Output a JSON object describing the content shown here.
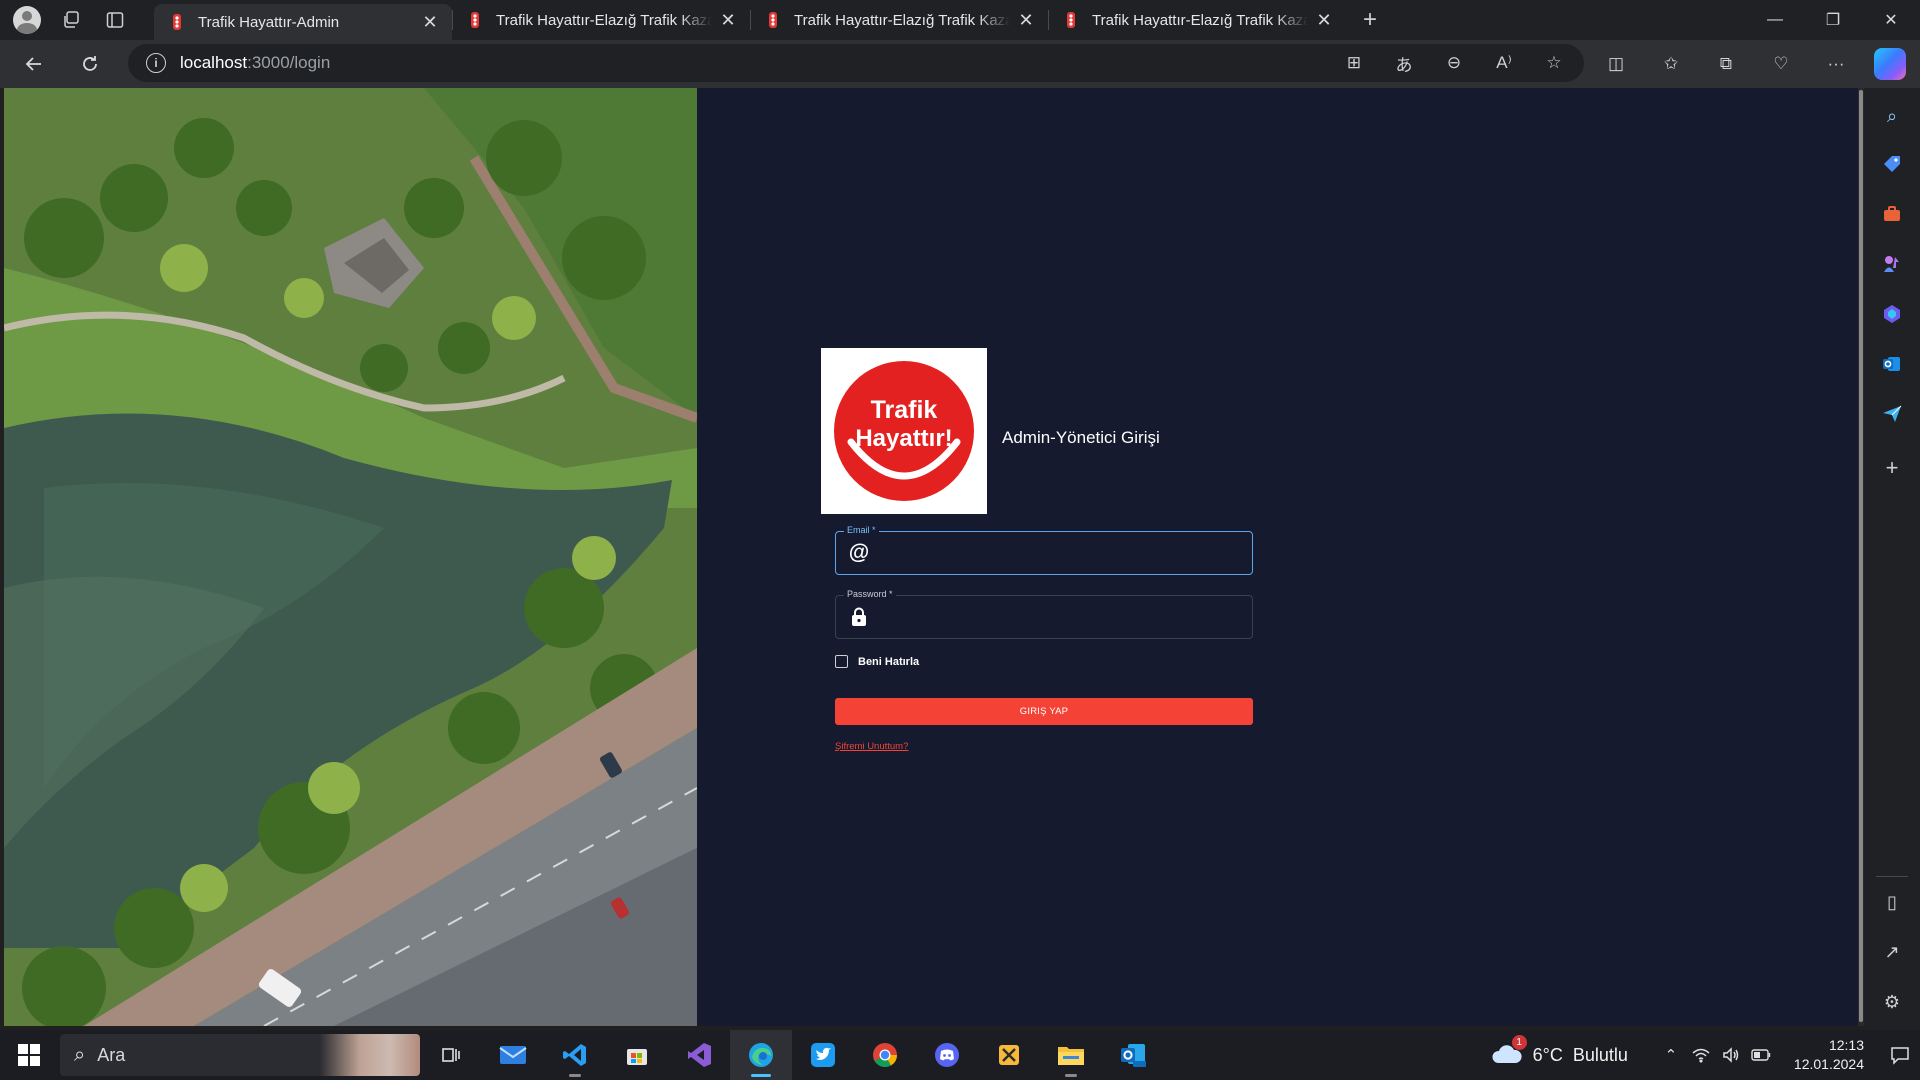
{
  "browser": {
    "tabs": [
      {
        "title": "Trafik Hayattır-Admin",
        "active": true
      },
      {
        "title": "Trafik Hayattır-Elazığ Trafik Kazaları",
        "active": false
      },
      {
        "title": "Trafik Hayattır-Elazığ Trafik Kazaları",
        "active": false
      },
      {
        "title": "Trafik Hayattır-Elazığ Trafik Kazaları",
        "active": false
      }
    ],
    "url_host": "localhost",
    "url_path": ":3000/login",
    "accent": "#4cc2ff"
  },
  "login": {
    "logo_line1": "Trafik",
    "logo_line2": "Hayattır!",
    "heading": "Admin-Yönetici Girişi",
    "email_label": "Email *",
    "email_value": "",
    "password_label": "Password *",
    "password_value": "",
    "remember_label": "Beni Hatırla",
    "remember_checked": false,
    "submit_label": "GIRIŞ YAP",
    "forgot_label": "Şifremi Unuttum?",
    "brand_color": "#f44336",
    "background": "#151a2e"
  },
  "taskbar": {
    "search_placeholder": "Ara",
    "weather_temp": "6°C",
    "weather_desc": "Bulutlu",
    "weather_badge": "1",
    "time": "12:13",
    "date": "12.01.2024"
  }
}
